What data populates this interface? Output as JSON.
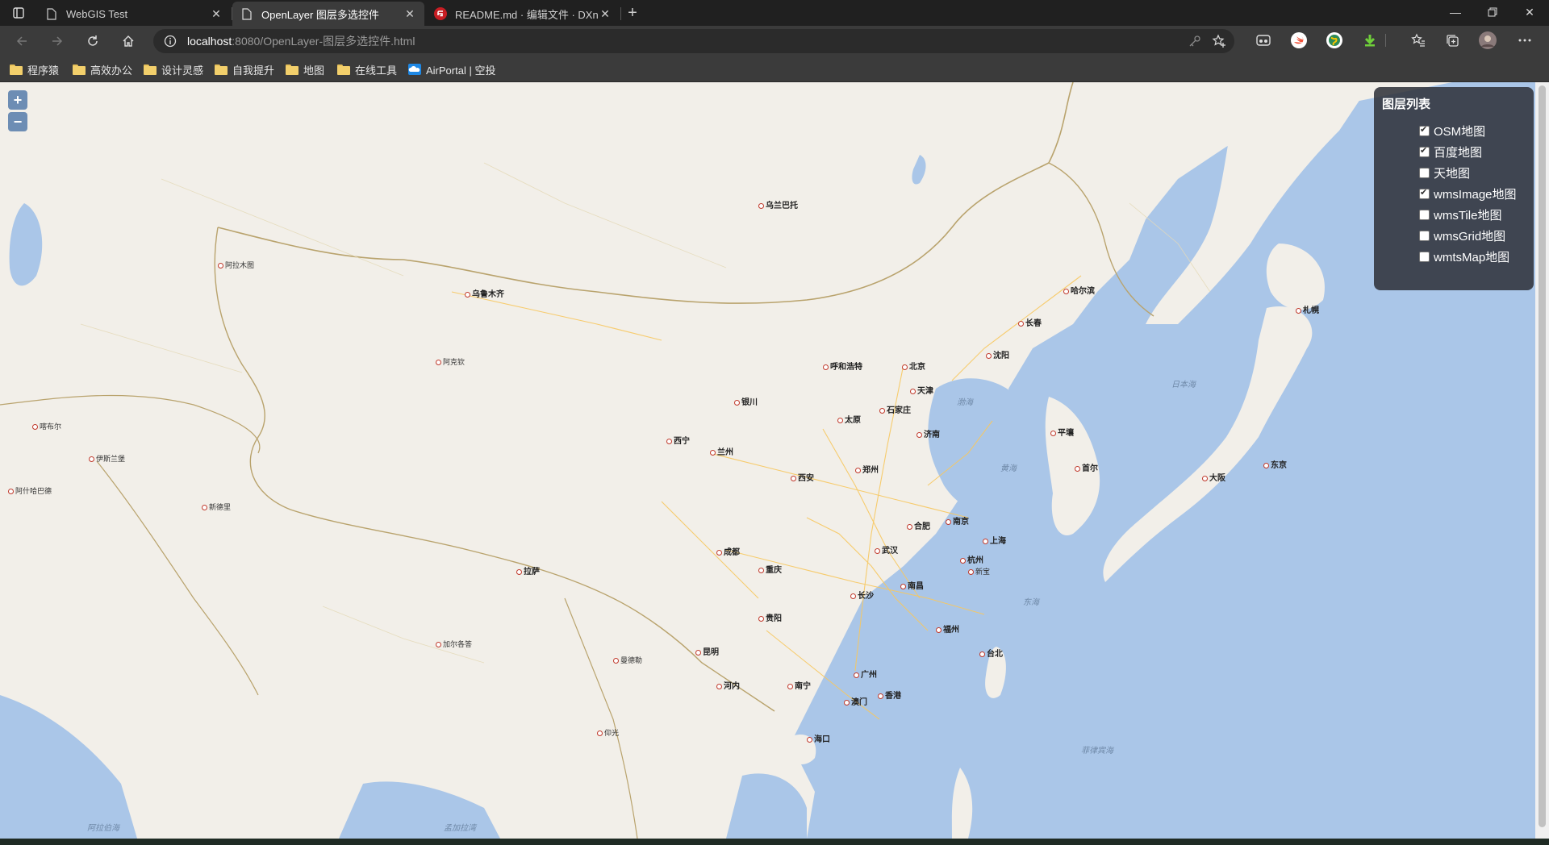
{
  "browser": {
    "tabs": [
      {
        "title": "WebGIS Test",
        "icon": "page-icon",
        "active": false
      },
      {
        "title": "OpenLayer 图层多选控件",
        "icon": "page-icon",
        "active": true
      },
      {
        "title": "README.md · 编辑文件 · DXnim",
        "icon": "gitee-icon",
        "active": false
      }
    ],
    "address": {
      "host": "localhost",
      "path": ":8080/OpenLayer-图层多选控件.html"
    },
    "bookmarks": [
      {
        "label": "程序猿",
        "icon": "folder-icon"
      },
      {
        "label": "高效办公",
        "icon": "folder-icon"
      },
      {
        "label": "设计灵感",
        "icon": "folder-icon"
      },
      {
        "label": "自我提升",
        "icon": "folder-icon"
      },
      {
        "label": "地图",
        "icon": "folder-icon"
      },
      {
        "label": "在线工具",
        "icon": "folder-icon"
      },
      {
        "label": "AirPortal | 空投",
        "icon": "airportal-icon"
      }
    ]
  },
  "map": {
    "zoom": {
      "in": "+",
      "out": "−"
    },
    "layer_panel": {
      "title": "图层列表",
      "layers": [
        {
          "label": "OSM地图",
          "checked": true
        },
        {
          "label": "百度地图",
          "checked": true
        },
        {
          "label": "天地图",
          "checked": false
        },
        {
          "label": "wmsImage地图",
          "checked": true
        },
        {
          "label": "wmsTile地图",
          "checked": false
        },
        {
          "label": "wmsGrid地图",
          "checked": false
        },
        {
          "label": "wmtsMap地图",
          "checked": false
        }
      ]
    },
    "places": {
      "beijing": "北京",
      "tianjin": "天津",
      "shijiazhuang": "石家庄",
      "taiyuan": "太原",
      "jinan": "济南",
      "zhengzhou": "郑州",
      "xian": "西安",
      "lanzhou": "兰州",
      "xining": "西宁",
      "yinchuan": "银川",
      "huhehaote": "呼和浩特",
      "shenyang": "沈阳",
      "changchun": "长春",
      "haerbin": "哈尔滨",
      "nanjing": "南京",
      "shanghai": "上海",
      "hangzhou": "杭州",
      "hefei": "合肥",
      "wuhan": "武汉",
      "changsha": "长沙",
      "nanchang": "南昌",
      "fuzhou": "福州",
      "taibei": "台北",
      "guangzhou": "广州",
      "xianggang": "香港",
      "aomen": "澳门",
      "nanning": "南宁",
      "haikou": "海口",
      "guiyang": "贵阳",
      "kunming": "昆明",
      "chengdu": "成都",
      "chongqing": "重庆",
      "lasa": "拉萨",
      "wulumuqi": "乌鲁木齐",
      "wulanbatuo": "乌兰巴托",
      "pingrang": "平壤",
      "shouer": "首尔",
      "dongjing": "东京",
      "dabang": "大阪",
      "zhaohuang": "札幌",
      "xinbao": "新宝",
      "bohai": "渤海",
      "huanghai": "黄海",
      "donghai": "东海",
      "ribenhai": "日本海",
      "feilvbinhai": "菲律宾海",
      "mengjialawan": "孟加拉湾",
      "alabohai": "阿拉伯海",
      "hanoi": "河内",
      "mandelei": "曼德勒",
      "yangguang": "仰光",
      "xindeli": "新德里",
      "jiaerge": "加尔各答",
      "kabuer": "喀布尔",
      "yisilanbao": "伊斯兰堡",
      "ahamaiti": "阿拉木图",
      "ashihabade": "阿什哈巴德",
      "akeqin": "阿克钦"
    }
  }
}
